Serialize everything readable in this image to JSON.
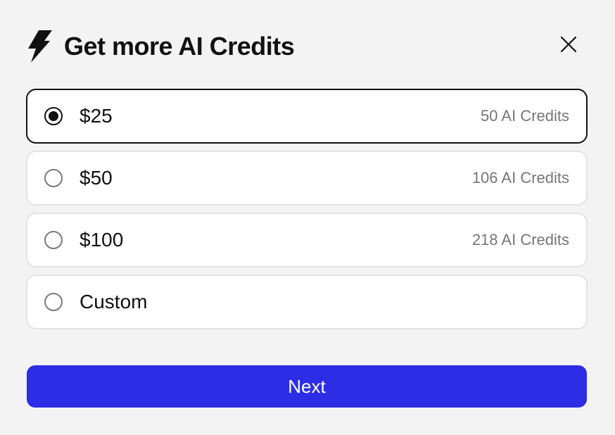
{
  "dialog": {
    "title": "Get more AI Credits",
    "icon": "lightning-bolt-icon",
    "close_icon": "close-icon"
  },
  "options": [
    {
      "amount": "$25",
      "credits": "50 AI Credits",
      "selected": true
    },
    {
      "amount": "$50",
      "credits": "106 AI Credits",
      "selected": false
    },
    {
      "amount": "$100",
      "credits": "218 AI Credits",
      "selected": false
    },
    {
      "amount": "Custom",
      "credits": "",
      "selected": false
    }
  ],
  "next_button": {
    "label": "Next"
  },
  "colors": {
    "background": "#f3f3f3",
    "primary_button": "#2d2de6",
    "selected_border": "#111111",
    "card_border": "#e3e3e3",
    "muted_text": "#777777"
  }
}
